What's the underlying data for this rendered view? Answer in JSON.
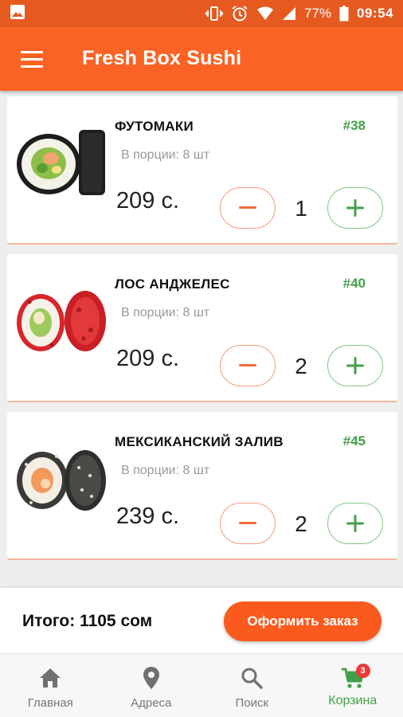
{
  "status_bar": {
    "battery": "77%",
    "time": "09:54"
  },
  "app_bar": {
    "title": "Fresh Box Sushi"
  },
  "items": [
    {
      "name": "ФУТОМАКИ",
      "number": "#38",
      "portion": "В порции: 8 шт",
      "price": "209 с.",
      "quantity": "1"
    },
    {
      "name": "ЛОС АНДЖЕЛЕС",
      "number": "#40",
      "portion": "В порции: 8 шт",
      "price": "209 с.",
      "quantity": "2"
    },
    {
      "name": "МЕКСИКАНСКИЙ ЗАЛИВ",
      "number": "#45",
      "portion": "В порции: 8 шт",
      "price": "239 с.",
      "quantity": "2"
    }
  ],
  "total": {
    "label": "Итого: 1105 сом",
    "checkout_label": "Оформить заказ"
  },
  "bottom_nav": {
    "items": [
      {
        "label": "Главная",
        "icon": "home-icon"
      },
      {
        "label": "Адреса",
        "icon": "location-pin-icon"
      },
      {
        "label": "Поиск",
        "icon": "search-icon"
      },
      {
        "label": "Корзина",
        "icon": "cart-icon",
        "active": true,
        "badge": "3"
      }
    ]
  },
  "colors": {
    "brand": "#fb6324",
    "accent_green": "#43a047",
    "badge": "#ea3a3a"
  }
}
